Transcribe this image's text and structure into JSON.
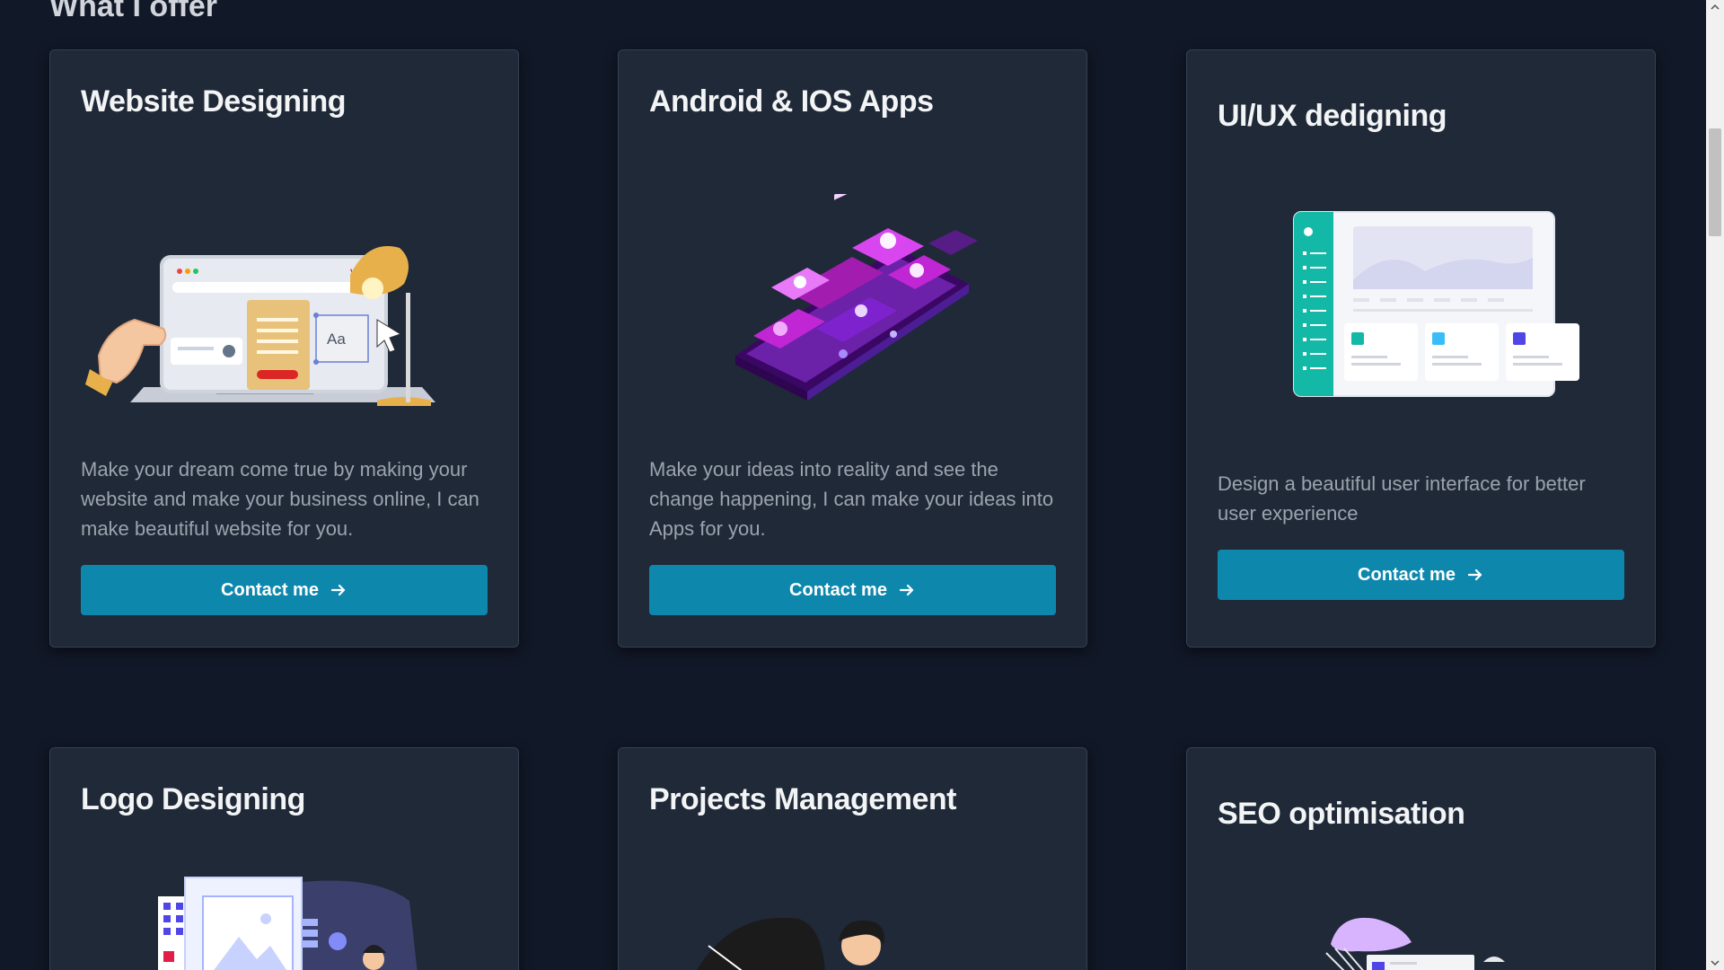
{
  "section": {
    "title": "What I offer"
  },
  "cards": [
    {
      "title": "Website Designing",
      "description": "Make your dream come true by making your website and make your business online, I can make beautiful website for you.",
      "button": "Contact me",
      "illustration_text": "Aa"
    },
    {
      "title": "Android & IOS Apps",
      "description": "Make your ideas into reality and see the change happening, I can make your ideas into Apps for you.",
      "button": "Contact me"
    },
    {
      "title": "UI/UX dedigning",
      "description": "Design a beautiful user interface for better user experience",
      "button": "Contact me"
    },
    {
      "title": "Logo Designing"
    },
    {
      "title": "Projects Management"
    },
    {
      "title": "SEO optimisation"
    }
  ],
  "colors": {
    "background": "#111827",
    "card": "#1f2937",
    "button": "#0e87ad",
    "text_muted": "#9ca3af"
  }
}
